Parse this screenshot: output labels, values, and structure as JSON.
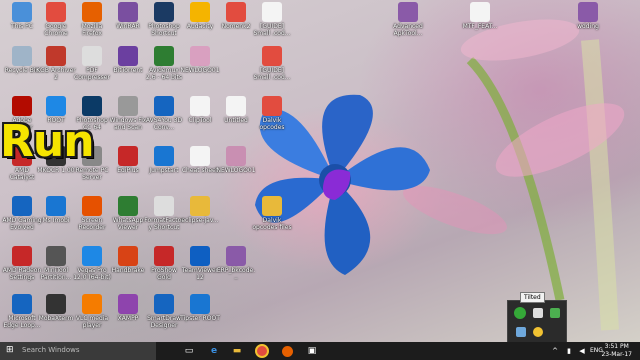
{
  "overlay_text": "Run",
  "tooltip": "Tilted",
  "taskbar": {
    "search_placeholder": "Search Windows",
    "language": "ENG",
    "time": "3:51 PM",
    "date": "23-Mar-17"
  },
  "icons": [
    {
      "label": "This PC",
      "icon": "computer-icon",
      "color": "#4a90d9"
    },
    {
      "label": "Google Chrome",
      "icon": "chrome-icon",
      "color": "#e24c3f"
    },
    {
      "label": "Mozilla Firefox",
      "icon": "firefox-icon",
      "color": "#e66000"
    },
    {
      "label": "WinRAR",
      "icon": "winrar-icon",
      "color": "#7a4fa0"
    },
    {
      "label": "Photoshop Shortcut",
      "icon": "photoshop-icon",
      "color": "#1b3a63"
    },
    {
      "label": "Audacity",
      "icon": "audacity-icon",
      "color": "#f5b400"
    },
    {
      "label": "Nomenk2",
      "icon": "chrome-icon",
      "color": "#e24c3f"
    },
    {
      "label": "[GUIDE] Small .cod...",
      "icon": "file-icon",
      "color": "#f4f4f4"
    },
    {
      "label": "Advanced ApkTool...",
      "icon": "winrar-icon",
      "color": "#8a5aa8"
    },
    {
      "label": "MTF_FEAT...",
      "icon": "file-icon",
      "color": "#f4f4f4"
    },
    {
      "label": "wdding",
      "icon": "winrar-icon",
      "color": "#8a5aa8"
    },
    {
      "label": "Recycle Bin",
      "icon": "recycle-bin-icon",
      "color": "#9fb4c8"
    },
    {
      "label": "KGB Archiver 2",
      "icon": "archive-icon",
      "color": "#c0392b"
    },
    {
      "label": "PDF Compresser",
      "icon": "pdf-icon",
      "color": "#ddd"
    },
    {
      "label": "BitTorrent",
      "icon": "bittorrent-icon",
      "color": "#6b3fa0"
    },
    {
      "label": "Avidemux 2.6 - 64 bits",
      "icon": "avidemux-icon",
      "color": "#2e7d32"
    },
    {
      "label": "NEWLOGO01",
      "icon": "image-icon",
      "color": "#d9a0c0"
    },
    {
      "label": "[GUIDE] Small .cod...",
      "icon": "chrome-icon",
      "color": "#e24c3f"
    },
    {
      "label": "Adobe Reader",
      "icon": "adobe-reader-icon",
      "color": "#b30b00"
    },
    {
      "label": "ROOT",
      "icon": "root-icon",
      "color": "#1e88e5"
    },
    {
      "label": "Photoshop CC 64",
      "icon": "photoshop-icon",
      "color": "#0b3a66"
    },
    {
      "label": "Windows Fix and Scan",
      "icon": "tools-icon",
      "color": "#999"
    },
    {
      "label": "AVS4You 3D Conv...",
      "icon": "avs-icon",
      "color": "#1565c0"
    },
    {
      "label": "ClipTool",
      "icon": "file-icon",
      "color": "#f4f4f4"
    },
    {
      "label": "Untitled",
      "icon": "file-icon",
      "color": "#f4f4f4"
    },
    {
      "label": "Dalvik opcodes",
      "icon": "chrome-icon",
      "color": "#e24c3f"
    },
    {
      "label": "AMD Catalyst",
      "icon": "amd-icon",
      "color": "#c62828"
    },
    {
      "label": "MKOCR 1.00",
      "icon": "ocr-icon",
      "color": "#333"
    },
    {
      "label": "Remote PC Server",
      "icon": "remote-icon",
      "color": "#888"
    },
    {
      "label": "EdiPlus",
      "icon": "editor-icon",
      "color": "#c62828"
    },
    {
      "label": "Jumpstart",
      "icon": "jumpstart-icon",
      "color": "#1976d2"
    },
    {
      "label": "Cheat sheet",
      "icon": "file-icon",
      "color": "#f4f4f4"
    },
    {
      "label": "NEWLOGO01",
      "icon": "image-icon",
      "color": "#c98fb2"
    },
    {
      "label": "AMD Gaming Evolved",
      "icon": "amd-icon",
      "color": "#1565c0"
    },
    {
      "label": "Ms Imobi",
      "icon": "wifi-icon",
      "color": "#1976d2"
    },
    {
      "label": "Screen Recorder",
      "icon": "recorder-icon",
      "color": "#e65100"
    },
    {
      "label": "WhatsApp Viewer",
      "icon": "whatsapp-icon",
      "color": "#2e7d32"
    },
    {
      "label": "FormatFactory Shortcut",
      "icon": "format-icon",
      "color": "#ddd"
    },
    {
      "label": "eclipse-jav...",
      "icon": "folder-icon",
      "color": "#e8b93a"
    },
    {
      "label": "Dalvik opcodes files",
      "icon": "folder-icon",
      "color": "#e8b93a"
    },
    {
      "label": "AMD Radeon Settings",
      "icon": "amd-icon",
      "color": "#c62828"
    },
    {
      "label": "MiniTool Partition...",
      "icon": "partition-icon",
      "color": "#555"
    },
    {
      "label": "Vegas Pro 12.0 (64-bit)",
      "icon": "vegas-icon",
      "color": "#1e88e5"
    },
    {
      "label": "Handbrake",
      "icon": "handbrake-icon",
      "color": "#d84315"
    },
    {
      "label": "ProShow Gold",
      "icon": "proshow-icon",
      "color": "#c62828"
    },
    {
      "label": "TeamViewer 12",
      "icon": "teamviewer-icon",
      "color": "#0e5fc2"
    },
    {
      "label": "ERP_bkcode...",
      "icon": "winrar-icon",
      "color": "#8a5aa8"
    },
    {
      "label": "Microsoft Edge Loop...",
      "icon": "edge-icon",
      "color": "#1565c0"
    },
    {
      "label": "MobaXterm",
      "icon": "terminal-icon",
      "color": "#333"
    },
    {
      "label": "VLC media player",
      "icon": "vlc-icon",
      "color": "#f57c00"
    },
    {
      "label": "XAMPP",
      "icon": "xampp-icon",
      "color": "#8e44ad"
    },
    {
      "label": "SmartDraw Designer",
      "icon": "smartdraw-icon",
      "color": "#1565c0"
    },
    {
      "label": "Tipster ROOT",
      "icon": "tipster-icon",
      "color": "#1976d2"
    }
  ]
}
